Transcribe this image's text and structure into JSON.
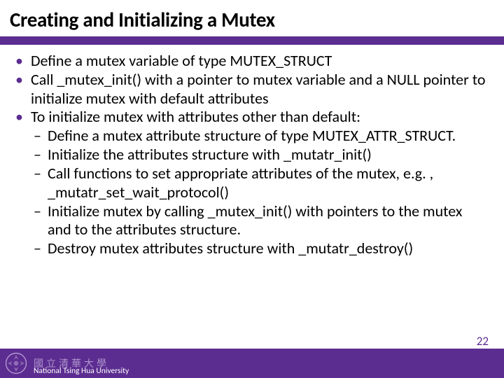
{
  "slide": {
    "title": "Creating and Initializing a Mutex",
    "bullets": [
      {
        "text": "Define a mutex variable of type MUTEX_STRUCT"
      },
      {
        "text": "Call _mutex_init() with a pointer to mutex variable and a NULL pointer to initialize mutex with default attributes"
      },
      {
        "text": "To initialize mutex with attributes other than default:",
        "sub": [
          "Define a mutex attribute structure of type MUTEX_ATTR_STRUCT.",
          "Initialize the attributes structure with _mutatr_init()",
          "Call functions to set appropriate attributes of the mutex, e.g. , _mutatr_set_wait_protocol()",
          "Initialize mutex by calling _mutex_init() with pointers to the mutex and to the attributes structure.",
          "Destroy mutex attributes structure with _mutatr_destroy()"
        ]
      }
    ]
  },
  "footer": {
    "cn_name": "國立清華大學",
    "en_name": "National Tsing Hua University"
  },
  "page_number": "22",
  "colors": {
    "accent": "#5c2d91"
  }
}
